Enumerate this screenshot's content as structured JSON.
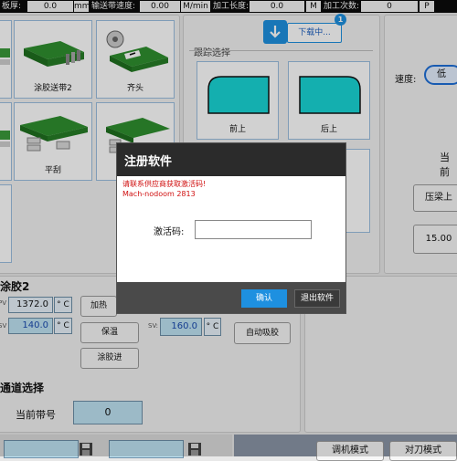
{
  "topbar": {
    "plate_label": "板厚:",
    "plate_value": "0.0",
    "plate_unit": "mm",
    "belt_speed_label": "输送带速度:",
    "belt_speed_value": "0.00",
    "belt_speed_unit": "M/min",
    "length_label": "加工长度:",
    "length_value": "0.0",
    "length_unit": "M",
    "count_label": "加工次数:",
    "count_value": "0",
    "count_unit": "P"
  },
  "tiles": {
    "glue_feed2": "涂胶送带2",
    "trim_head": "齐头",
    "flat_scrape": "平刮"
  },
  "tracking": {
    "title": "跟踪选择",
    "download_label": "下载中...",
    "badge_count": "1",
    "front_top": "前上",
    "back_top": "后上"
  },
  "right_panel": {
    "speed_label": "速度:",
    "speed_value": "低",
    "current_label": "当前",
    "press_label": "压梁上",
    "value_display": "15.00"
  },
  "glue2": {
    "title": "涂胶2",
    "pv_prefix": "PV",
    "pv_value": "1372.0",
    "sv_prefix": "SV",
    "sv_value": "140.0",
    "unit": "° C",
    "heat_button": "加热",
    "keep_warm_button": "保温",
    "glue_in_button": "涂胶进",
    "sv2_prefix": "SV:",
    "sv2_value": "160.0",
    "auto_suck_button": "自动吸胶"
  },
  "channel": {
    "title": "通道选择",
    "current_belt_label": "当前带号",
    "current_belt_value": "0"
  },
  "bottom": {
    "debug_mode_button": "调机模式",
    "knife_mode_button": "对刀模式"
  },
  "modal": {
    "title": "注册软件",
    "error_line1": "请联系供应商获取激活码!",
    "error_line2": "Mach-nodoom 2813",
    "activation_label": "激活码:",
    "activation_value": "",
    "confirm_button": "确认",
    "exit_button": "退出软件"
  },
  "colors": {
    "accent_blue": "#1e90e0",
    "error_red": "#d01010",
    "field_blue": "#bfe3f3",
    "modal_dark": "#2b2b2b"
  }
}
